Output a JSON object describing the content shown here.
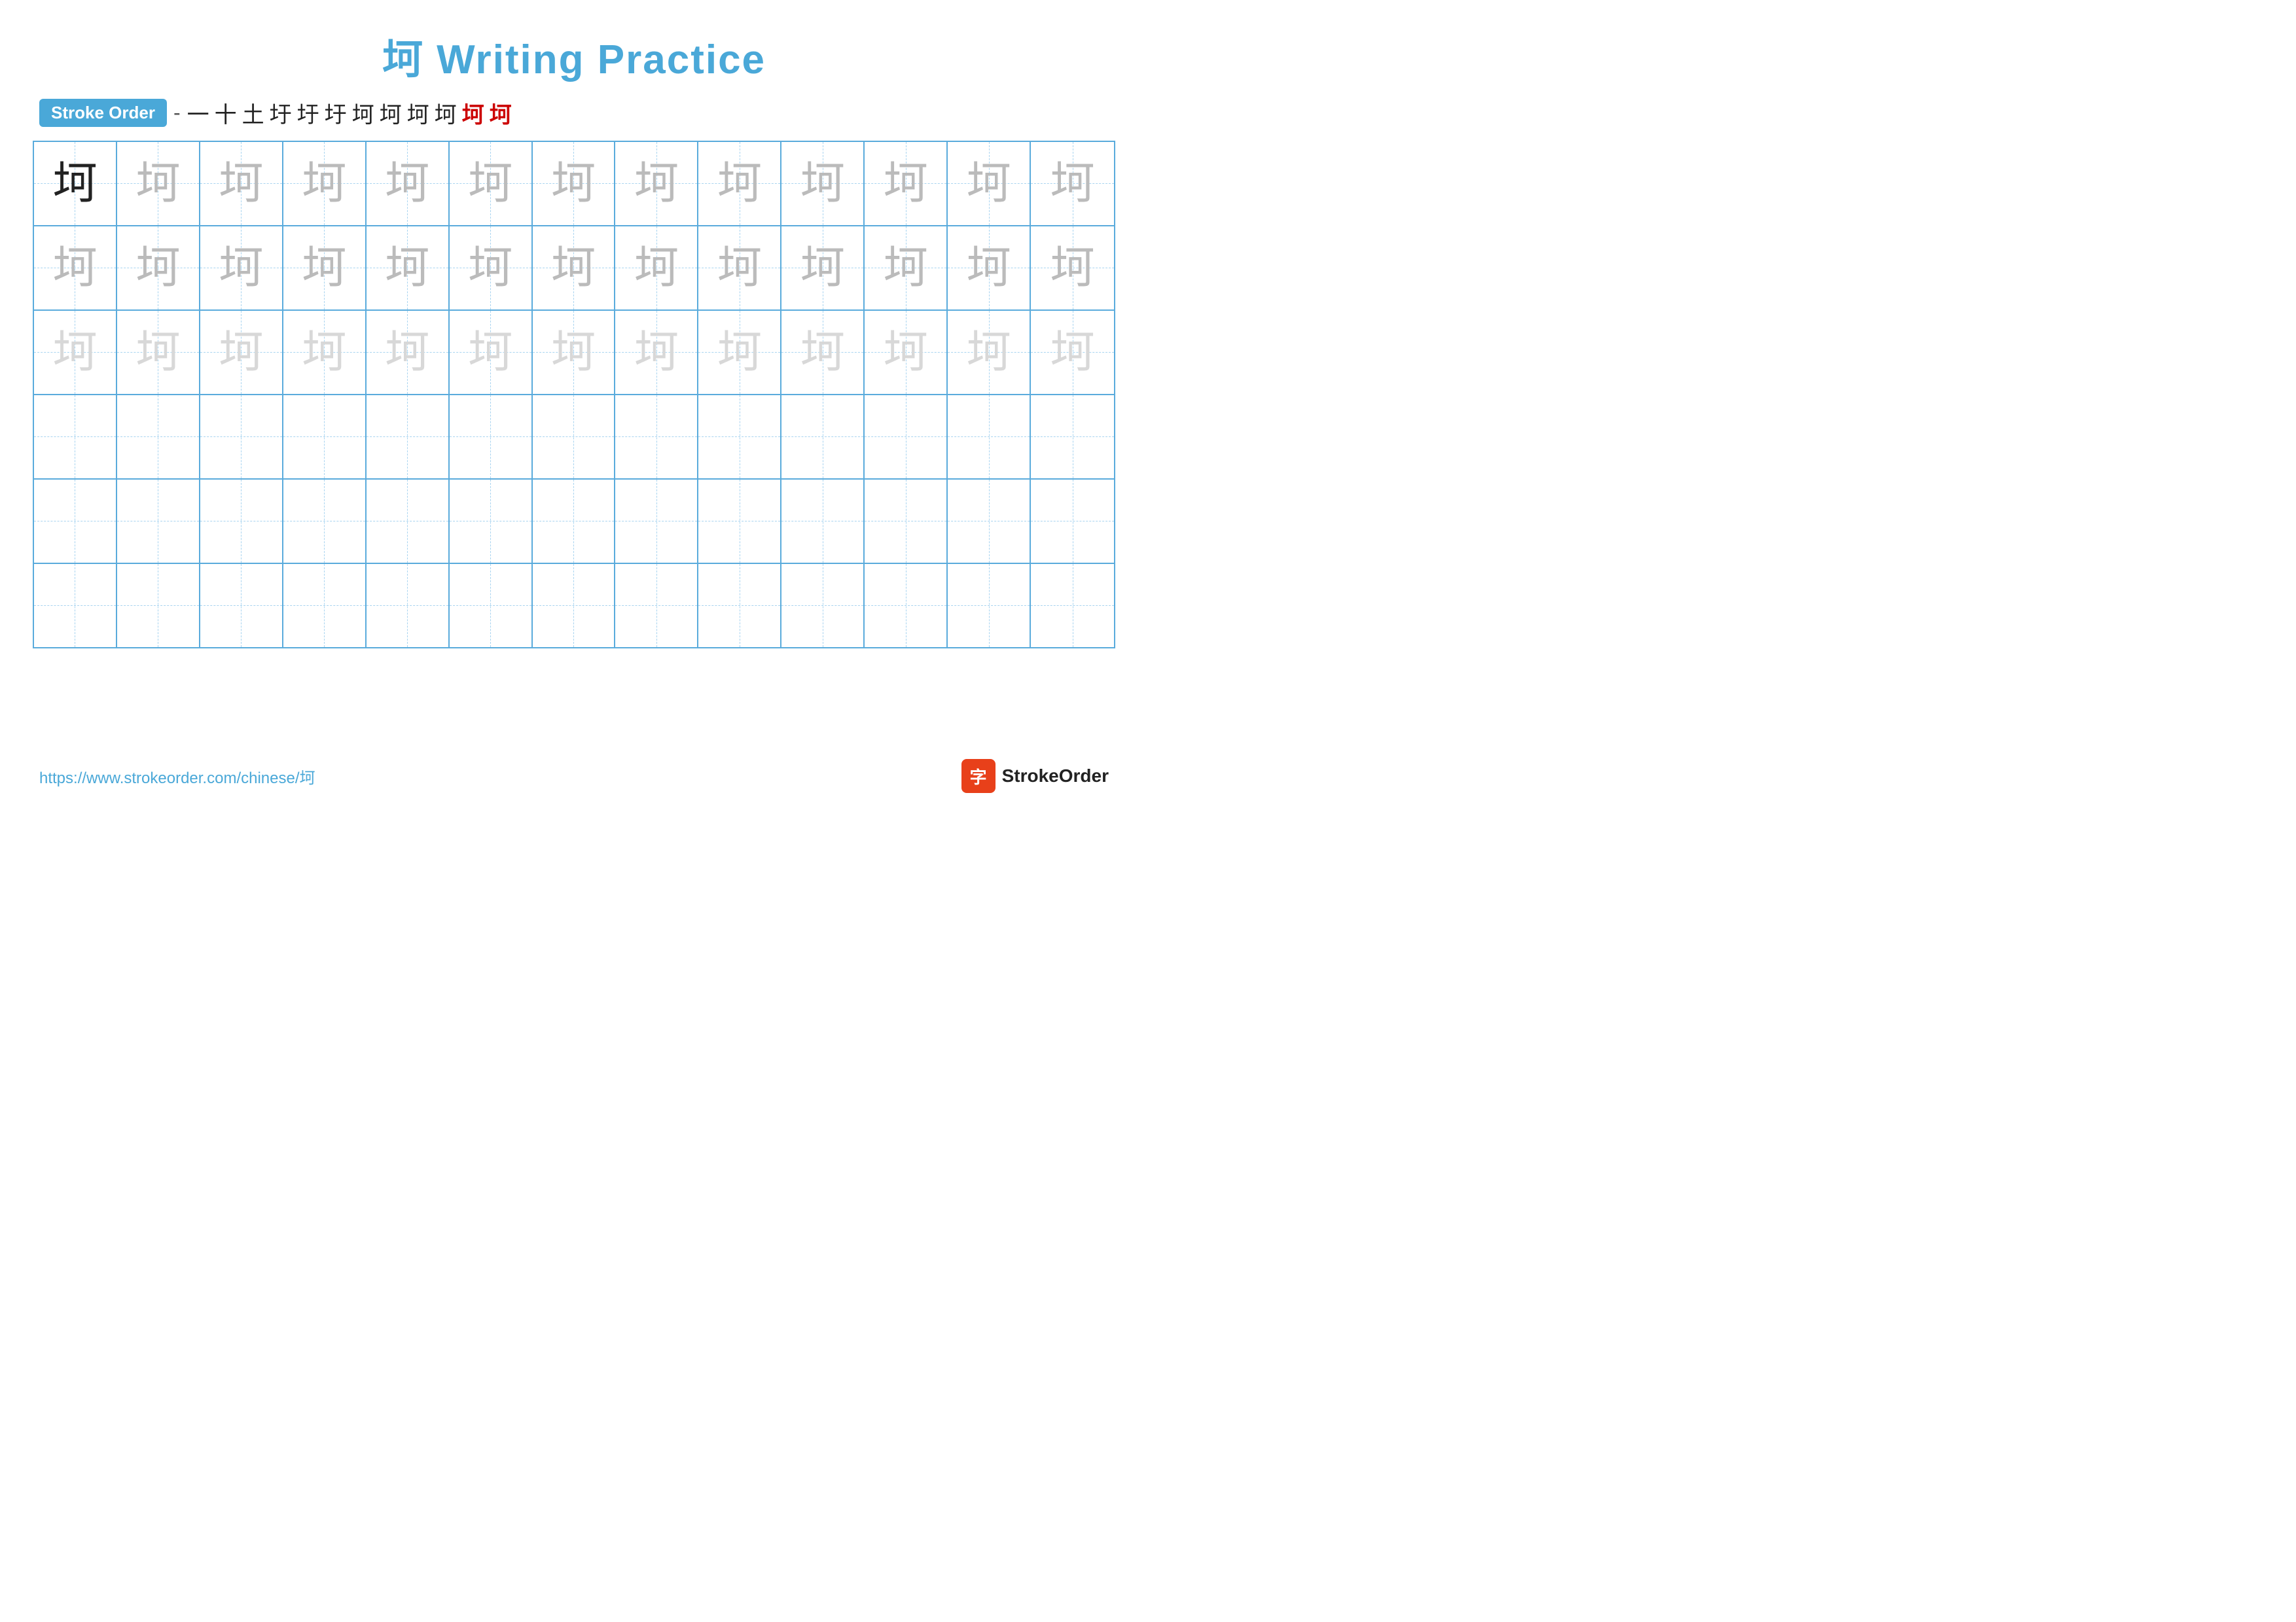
{
  "title": {
    "text": "坷 Writing Practice",
    "color": "#4aa8d8"
  },
  "stroke_order": {
    "badge": "Stroke Order",
    "strokes": [
      "一",
      "十",
      "土",
      "土",
      "扩",
      "扩",
      "扩",
      "扩",
      "扩",
      "坷",
      "坷",
      "坷"
    ]
  },
  "character": "坷",
  "grid": {
    "rows": 6,
    "cols": 13,
    "row_data": [
      [
        "dark",
        "medium",
        "medium",
        "medium",
        "medium",
        "medium",
        "medium",
        "medium",
        "medium",
        "medium",
        "medium",
        "medium",
        "medium"
      ],
      [
        "medium",
        "medium",
        "medium",
        "medium",
        "medium",
        "medium",
        "medium",
        "medium",
        "medium",
        "medium",
        "medium",
        "medium",
        "medium"
      ],
      [
        "light",
        "light",
        "light",
        "light",
        "light",
        "light",
        "light",
        "light",
        "light",
        "light",
        "light",
        "light",
        "light"
      ],
      [
        "empty",
        "empty",
        "empty",
        "empty",
        "empty",
        "empty",
        "empty",
        "empty",
        "empty",
        "empty",
        "empty",
        "empty",
        "empty"
      ],
      [
        "empty",
        "empty",
        "empty",
        "empty",
        "empty",
        "empty",
        "empty",
        "empty",
        "empty",
        "empty",
        "empty",
        "empty",
        "empty"
      ],
      [
        "empty",
        "empty",
        "empty",
        "empty",
        "empty",
        "empty",
        "empty",
        "empty",
        "empty",
        "empty",
        "empty",
        "empty",
        "empty"
      ]
    ]
  },
  "footer": {
    "url": "https://www.strokeorder.com/chinese/坷",
    "logo_text": "StrokeOrder",
    "logo_icon": "字"
  }
}
